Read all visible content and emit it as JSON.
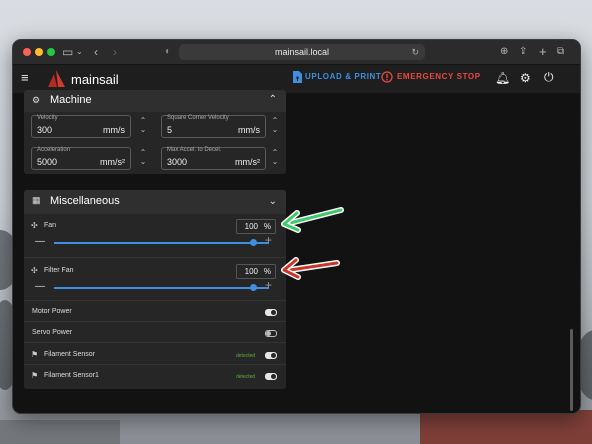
{
  "browser": {
    "url": "mainsail.local"
  },
  "app": {
    "brand": "mainsail",
    "upload_label": "UPLOAD & PRINT",
    "estop_label": "EMERGENCY STOP",
    "accent": "#3f8fe0",
    "danger": "#e64a43"
  },
  "machine": {
    "title": "Machine",
    "fields": [
      {
        "label": "Velocity",
        "value": "300",
        "unit": "mm/s"
      },
      {
        "label": "Square Corner Velocity",
        "value": "5",
        "unit": "mm/s"
      },
      {
        "label": "Acceleration",
        "value": "5000",
        "unit": "mm/s²"
      },
      {
        "label": "Max Accel. to Decel.",
        "value": "3000",
        "unit": "mm/s²"
      }
    ]
  },
  "misc": {
    "title": "Miscellaneous",
    "fans": [
      {
        "label": "Fan",
        "value": "100",
        "unit": "%",
        "level": 1.0
      },
      {
        "label": "Filter Fan",
        "value": "100",
        "unit": "%",
        "level": 1.0
      }
    ],
    "outputs": [
      {
        "label": "Motor Power",
        "on": true
      },
      {
        "label": "Servo Power",
        "on": false
      }
    ],
    "sensors": [
      {
        "label": "Filament Sensor",
        "status": "detected",
        "on": true
      },
      {
        "label": "Filament Sensor1",
        "status": "detected",
        "on": true
      }
    ]
  },
  "annotations": {
    "green_arrow_color": "#3ec96b",
    "red_arrow_color": "#c9372c"
  }
}
